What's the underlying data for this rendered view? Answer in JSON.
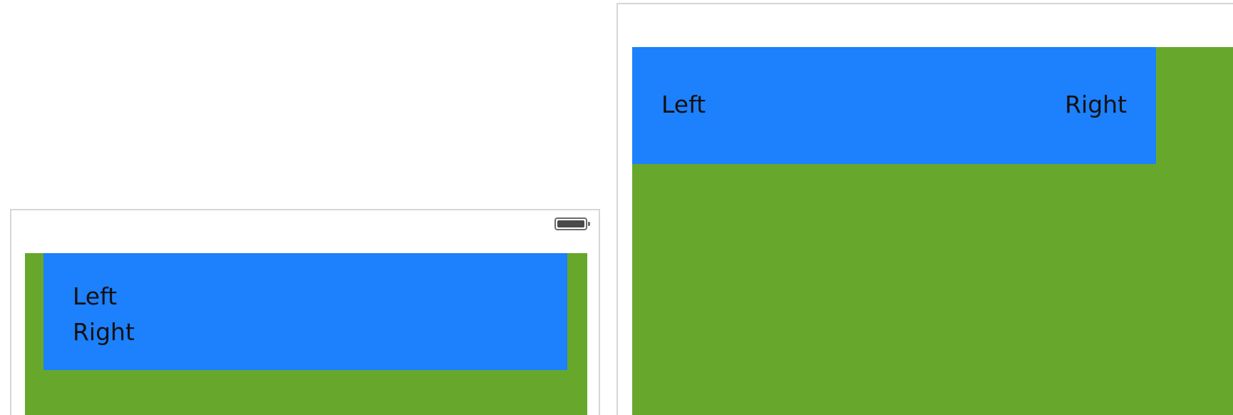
{
  "compact_preview": {
    "battery_icon": "battery-full-icon",
    "labels": {
      "left": "Left",
      "right": "Right"
    }
  },
  "regular_preview": {
    "labels": {
      "left": "Left",
      "right": "Right"
    }
  },
  "colors": {
    "container_background": "#67a82c",
    "stack_background": "#1d80fc",
    "label_text": "#111111",
    "device_border": "#d6d6d6"
  }
}
